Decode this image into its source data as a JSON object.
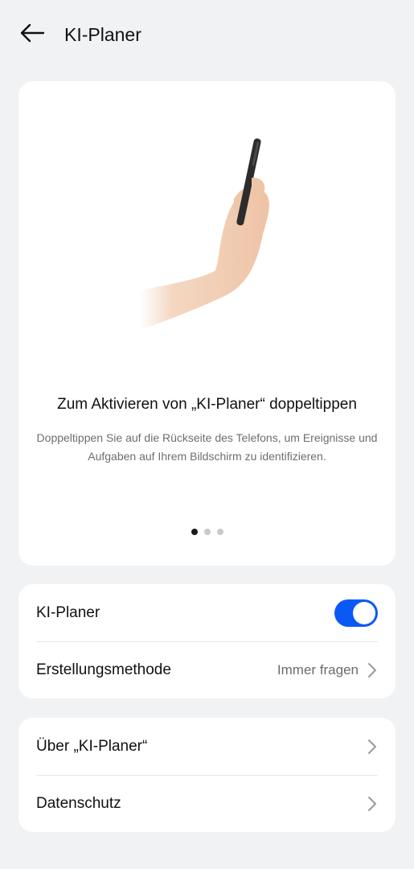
{
  "header": {
    "title": "KI-Planer",
    "back_icon": "arrow-left-icon"
  },
  "hero": {
    "illustration": "hand-holding-phone-illustration",
    "title": "Zum Aktivieren von „KI-Planer“ doppeltippen",
    "description": "Doppeltippen Sie auf die Rückseite des Telefons, um Ereignisse und Aufgaben auf Ihrem Bildschirm zu identifizieren.",
    "pagination": {
      "count": 3,
      "active": 1
    }
  },
  "settings": {
    "ki_planer": {
      "label": "KI-Planer",
      "enabled": true
    },
    "method": {
      "label": "Erstellungsmethode",
      "value": "Immer fragen"
    },
    "about": {
      "label": "Über „KI-Planer“"
    },
    "privacy": {
      "label": "Datenschutz"
    }
  },
  "colors": {
    "background": "#f1f2f4",
    "card": "#ffffff",
    "accent": "#0a59f7"
  }
}
